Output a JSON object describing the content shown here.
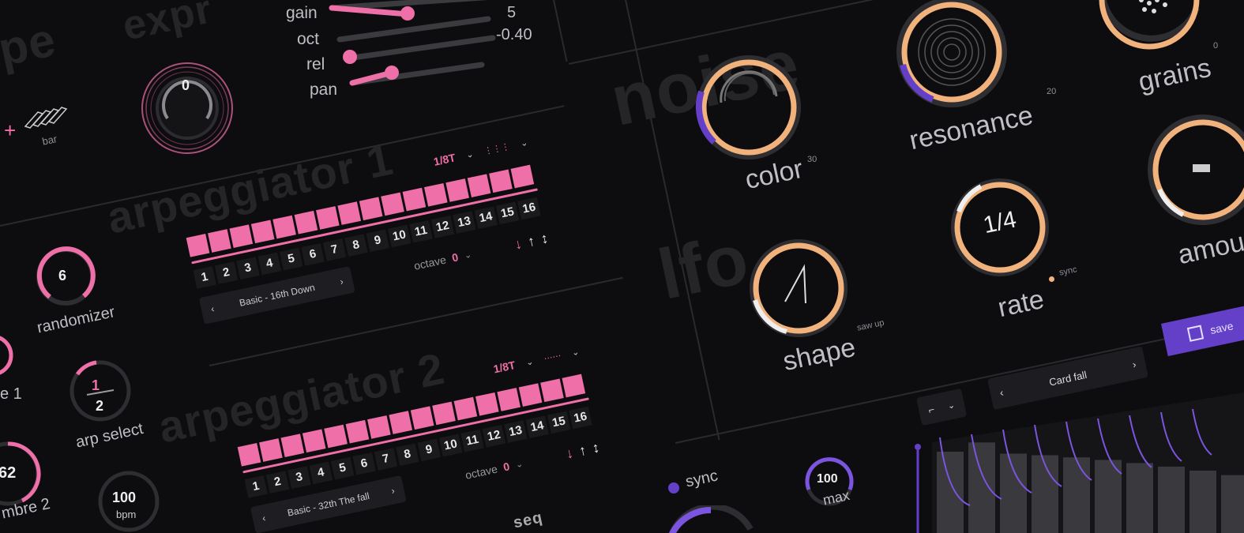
{
  "colors": {
    "accent_pink": "#ef6fa9",
    "accent_orange": "#f2b27c",
    "accent_purple": "#6440c8",
    "bg": "#0d0d0f"
  },
  "headers": {
    "expr": "expr",
    "pe": "pe",
    "noise": "noise",
    "lfo": "lfo",
    "arp1": "arpeggiator 1",
    "arp2": "arpeggiator 2",
    "seq": "seq"
  },
  "expr": {
    "knob_value": "0",
    "bar_label": "bar",
    "plus": "+"
  },
  "sliders": [
    {
      "label": "gain",
      "value": "5",
      "level": 0.75
    },
    {
      "label": "oct",
      "value": "-0.40",
      "level": 0.3
    },
    {
      "label": "rel",
      "value": "",
      "level": 0.0
    },
    {
      "label": "pan",
      "value": "",
      "level": 0.28
    }
  ],
  "left_controls": {
    "randomizer": {
      "label": "randomizer",
      "value": "6"
    },
    "arp_select": {
      "label": "arp select",
      "top": "1",
      "bottom": "2"
    },
    "timbre1": {
      "label": "e 1"
    },
    "timbre2": {
      "label": "mbre 2",
      "value": "62"
    },
    "bpm": {
      "value": "100",
      "unit": "bpm"
    }
  },
  "arp1": {
    "rate": "1/8T",
    "octave_label": "octave",
    "octave_value": "0",
    "steps": [
      "1",
      "2",
      "3",
      "4",
      "5",
      "6",
      "7",
      "8",
      "9",
      "10",
      "11",
      "12",
      "13",
      "14",
      "15",
      "16"
    ],
    "preset": "Basic - 16th Down",
    "arrows": [
      "↓",
      "↑",
      "↕"
    ]
  },
  "arp2": {
    "rate": "1/8T",
    "octave_label": "octave",
    "octave_value": "0",
    "steps": [
      "1",
      "2",
      "3",
      "4",
      "5",
      "6",
      "7",
      "8",
      "9",
      "10",
      "11",
      "12",
      "13",
      "14",
      "15",
      "16"
    ],
    "preset": "Basic - 32th The fall",
    "arrows": [
      "↓",
      "↑",
      "↕"
    ]
  },
  "noise": {
    "color": {
      "label": "color",
      "sup": "30"
    },
    "resonance": {
      "label": "resonance",
      "sup": "20"
    },
    "grains": {
      "label": "grains",
      "sup": "0"
    }
  },
  "lfo": {
    "shape": {
      "label": "shape",
      "sup": "saw up"
    },
    "rate": {
      "label": "rate",
      "sup": "sync",
      "value": "1/4"
    },
    "amount": {
      "label": "amou"
    }
  },
  "seq": {
    "save_label": "save",
    "preset": "Card fall",
    "sync_label": "sync",
    "max_label": "max",
    "max_value": "100",
    "bar_levels": [
      0.9,
      0.95,
      0.8,
      0.75,
      0.7,
      0.65,
      0.6,
      0.55,
      0.5,
      0.45,
      0.4
    ]
  }
}
